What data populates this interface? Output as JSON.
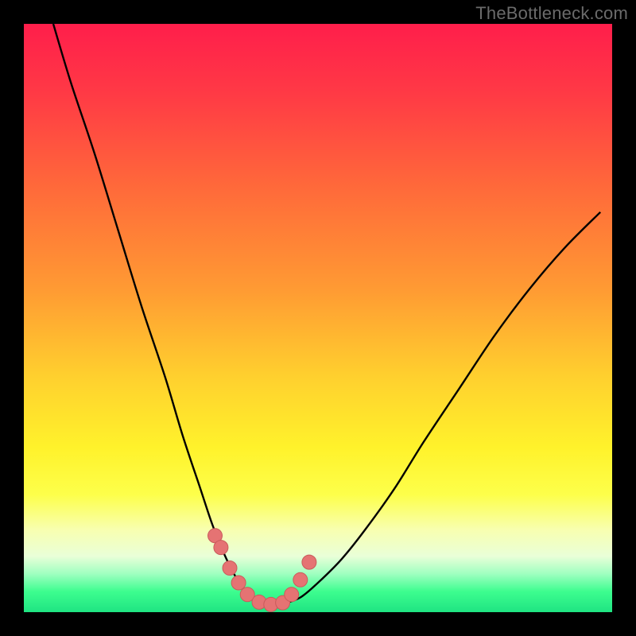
{
  "watermark": "TheBottleneck.com",
  "colors": {
    "frame": "#000000",
    "curve": "#000000",
    "marker_fill": "#e57373",
    "marker_stroke": "#c95b5b",
    "gradient_stops": [
      {
        "offset": 0.0,
        "color": "#ff1e4b"
      },
      {
        "offset": 0.12,
        "color": "#ff3a45"
      },
      {
        "offset": 0.28,
        "color": "#ff6a3a"
      },
      {
        "offset": 0.45,
        "color": "#ff9a33"
      },
      {
        "offset": 0.6,
        "color": "#ffd02e"
      },
      {
        "offset": 0.72,
        "color": "#fff22b"
      },
      {
        "offset": 0.8,
        "color": "#fdff4a"
      },
      {
        "offset": 0.86,
        "color": "#f8ffb0"
      },
      {
        "offset": 0.905,
        "color": "#e9ffd8"
      },
      {
        "offset": 0.935,
        "color": "#9fffc0"
      },
      {
        "offset": 0.965,
        "color": "#3dfd8f"
      },
      {
        "offset": 1.0,
        "color": "#1fe482"
      }
    ]
  },
  "chart_data": {
    "type": "line",
    "title": "",
    "xlabel": "",
    "ylabel": "",
    "xlim": [
      0,
      100
    ],
    "ylim": [
      0,
      100
    ],
    "series": [
      {
        "name": "bottleneck-curve",
        "x": [
          5,
          8,
          12,
          16,
          20,
          24,
          27,
          30,
          32,
          34,
          36,
          38,
          40,
          42,
          44,
          47,
          50,
          54,
          58,
          63,
          68,
          74,
          80,
          86,
          92,
          98
        ],
        "y": [
          100,
          90,
          78,
          65,
          52,
          40,
          30,
          21,
          15,
          10,
          6,
          3,
          1.5,
          1.2,
          1.4,
          2.5,
          5,
          9,
          14,
          21,
          29,
          38,
          47,
          55,
          62,
          68
        ]
      }
    ],
    "markers": {
      "name": "highlighted-points",
      "x": [
        32.5,
        33.5,
        35,
        36.5,
        38,
        40,
        42,
        44,
        45.5,
        47,
        48.5
      ],
      "y": [
        13,
        11,
        7.5,
        5,
        3,
        1.7,
        1.3,
        1.6,
        3,
        5.5,
        8.5
      ]
    }
  }
}
